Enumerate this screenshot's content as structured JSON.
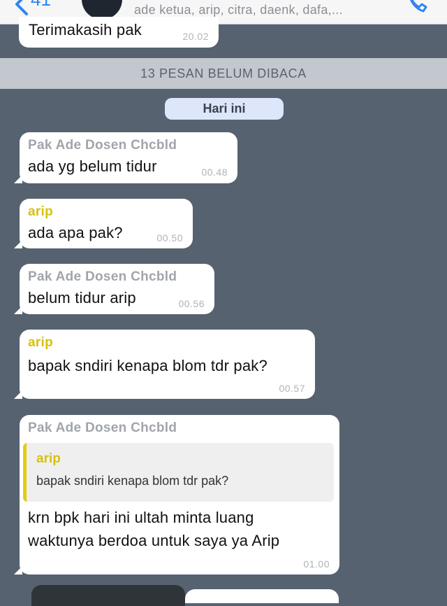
{
  "header": {
    "back_count": "41",
    "members": "ade ketua, arip, citra, daenk, dafa,..."
  },
  "top_message": {
    "text": "Terimakasih pak",
    "time": "20.02"
  },
  "unread_banner": "13 PESAN BELUM DIBACA",
  "date_separator": "Hari ini",
  "messages": [
    {
      "sender": "Pak Ade Dosen Chcbld",
      "text": "ada yg belum tidur",
      "time": "00.48"
    },
    {
      "sender": "arip",
      "text": "ada apa pak?",
      "time": "00.50"
    },
    {
      "sender": "Pak Ade Dosen Chcbld",
      "text": "belum tidur arip",
      "time": "00.56"
    },
    {
      "sender": "arip",
      "text": "bapak sndiri kenapa blom tdr pak?",
      "time": "00.57"
    },
    {
      "sender": "Pak Ade Dosen Chcbld",
      "reply_to": {
        "sender": "arip",
        "text": "bapak sndiri kenapa blom tdr pak?"
      },
      "lines": [
        "krn bpk hari ini ultah minta luang",
        "waktunya berdoa untuk saya ya Arip"
      ],
      "time": "01.00"
    }
  ],
  "colors": {
    "background": "#56626f",
    "bubble": "#ffffff",
    "sender_other": "#a1a5aa",
    "sender_arip": "#d8c10c",
    "accent_blue": "#2f84f2"
  },
  "icons": {
    "back": "chevron-left-icon",
    "call": "phone-icon"
  }
}
